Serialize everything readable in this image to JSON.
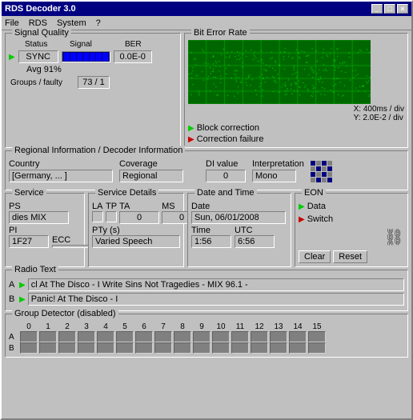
{
  "window": {
    "title": "RDS Decoder 3.0",
    "title_buttons": [
      "_",
      "□",
      "×"
    ]
  },
  "menu": {
    "items": [
      "File",
      "RDS",
      "System",
      "?"
    ]
  },
  "signal_quality": {
    "title": "Signal Quality",
    "status_label": "Status",
    "signal_label": "Signal",
    "ber_label": "BER",
    "status_value": "SYNC",
    "ber_value": "0.0E-0",
    "avg_text": "Avg 91%",
    "groups_label": "Groups / faulty",
    "groups_value": "73 / 1"
  },
  "bit_error_rate": {
    "title": "Bit Error Rate",
    "x_label": "X: 400ms / div",
    "y_label": "Y: 2.0E-2 / div",
    "block_label": "Block correction",
    "correction_label": "Correction failure"
  },
  "regional": {
    "title": "Regional Information / Decoder Information",
    "country_label": "Country",
    "country_value": "[Germany, ... ]",
    "coverage_label": "Coverage",
    "coverage_value": "Regional",
    "di_label": "DI value",
    "di_value": "0",
    "interp_label": "Interpretation",
    "interp_value": "Mono"
  },
  "service": {
    "title": "Service",
    "ps_label": "PS",
    "ps_value": "dies MIX",
    "pi_label": "PI",
    "ecc_label": "ECC",
    "pi_value": "1F27",
    "ecc_value": ""
  },
  "service_details": {
    "title": "Service Details",
    "la_label": "LA",
    "tp_label": "TP",
    "ta_label": "TA",
    "ms_label": "MS",
    "ta_value": "0",
    "tp_value": "0",
    "ms_value": "0",
    "pty_label": "PTy (s)",
    "pty_value": "Varied Speech"
  },
  "datetime": {
    "title": "Date and Time",
    "date_label": "Date",
    "date_value": "Sun, 06/01/2008",
    "time_label": "Time",
    "utc_label": "UTC",
    "time_value": "1:56",
    "utc_value": "6:56"
  },
  "eon": {
    "title": "EON",
    "data_label": "Data",
    "switch_label": "Switch",
    "clear_label": "Clear",
    "reset_label": "Reset"
  },
  "radio_text": {
    "title": "Radio Text",
    "a_label": "A",
    "b_label": "B",
    "a_value": "cl At The Disco - I Write Sins Not Tragedies - MIX 96.1 -",
    "b_value": "Panic! At The Disco - I"
  },
  "group_detector": {
    "title": "Group Detector (disabled)",
    "row_a_label": "A",
    "row_b_label": "B",
    "columns": [
      "0",
      "1",
      "2",
      "3",
      "4",
      "5",
      "6",
      "7",
      "8",
      "9",
      "10",
      "11",
      "12",
      "13",
      "14",
      "15"
    ]
  },
  "colors": {
    "green": "#00cc00",
    "red": "#cc0000",
    "blue": "#0000aa",
    "dark_green": "#006600"
  }
}
